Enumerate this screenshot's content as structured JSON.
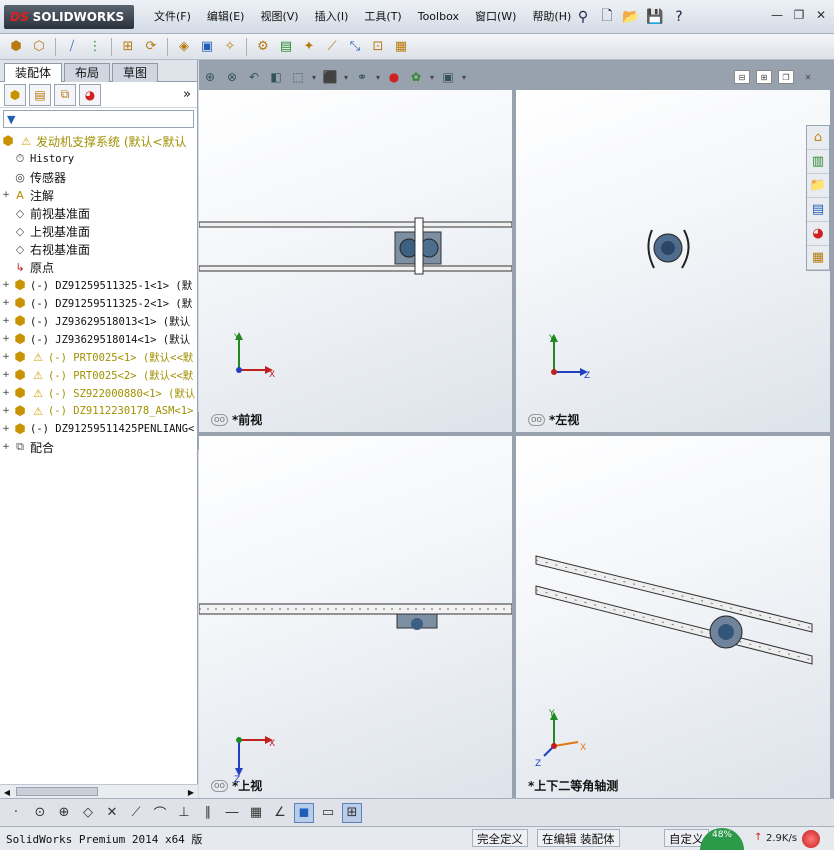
{
  "app": {
    "logo_prefix": "DS",
    "logo_text": "SOLIDWORKS"
  },
  "menu": [
    "文件(F)",
    "编辑(E)",
    "视图(V)",
    "插入(I)",
    "工具(T)",
    "Toolbox",
    "窗口(W)",
    "帮助(H)"
  ],
  "panel": {
    "tabs": [
      "装配体",
      "布局",
      "草图"
    ],
    "active_tab": "装配体",
    "more": "»"
  },
  "tree": {
    "root": "发动机支撑系统  (默认<默认",
    "items": [
      {
        "label": "History",
        "icon": "history-icon",
        "mono": true
      },
      {
        "label": "传感器",
        "icon": "sensor-icon"
      },
      {
        "label": "注解",
        "icon": "annotation-icon",
        "expand": "+"
      },
      {
        "label": "前视基准面",
        "icon": "plane-icon"
      },
      {
        "label": "上视基准面",
        "icon": "plane-icon"
      },
      {
        "label": "右视基准面",
        "icon": "plane-icon"
      },
      {
        "label": "原点",
        "icon": "origin-icon"
      },
      {
        "label": "(-) DZ91259511325-1<1> (默",
        "icon": "assembly-icon",
        "expand": "+",
        "mono": true
      },
      {
        "label": "(-) DZ91259511325-2<1> (默",
        "icon": "assembly-icon",
        "expand": "+",
        "mono": true
      },
      {
        "label": "(-) JZ93629518013<1> (默认",
        "icon": "assembly-icon",
        "expand": "+",
        "mono": true
      },
      {
        "label": "(-) JZ93629518014<1> (默认",
        "icon": "assembly-icon",
        "expand": "+",
        "mono": true
      },
      {
        "label": "(-) PRT0025<1> (默认<<默",
        "icon": "assembly-icon",
        "expand": "+",
        "warn": true,
        "mono": true
      },
      {
        "label": "(-) PRT0025<2> (默认<<默",
        "icon": "assembly-icon",
        "expand": "+",
        "warn": true,
        "mono": true
      },
      {
        "label": "(-) SZ922000880<1> (默认",
        "icon": "assembly-icon",
        "expand": "+",
        "warn": true,
        "mono": true
      },
      {
        "label": "(-) DZ9112230178_ASM<1>",
        "icon": "assembly-icon",
        "expand": "+",
        "warn": true,
        "mono": true
      },
      {
        "label": "(-) DZ91259511425PENLIANG<",
        "icon": "assembly-icon",
        "expand": "+",
        "mono": true
      },
      {
        "label": "配合",
        "icon": "mate-icon",
        "expand": "+"
      }
    ]
  },
  "viewports": {
    "front": "*前视",
    "left": "*左视",
    "top": "*上视",
    "iso": "*上下二等角轴测",
    "axis_x": "X",
    "axis_y": "Y",
    "axis_z": "Z"
  },
  "status": {
    "app_version": "SolidWorks Premium 2014 x64 版",
    "definition": "完全定义",
    "editing": "在编辑 装配体",
    "custom": "自定义",
    "net_percent": "48%",
    "net_speed": "2.9K/s"
  },
  "colors": {
    "accent": "#1f5fb5",
    "warning": "#d4a000",
    "axis_x": "#c02020",
    "axis_y": "#208a20",
    "axis_z": "#2040c0"
  }
}
